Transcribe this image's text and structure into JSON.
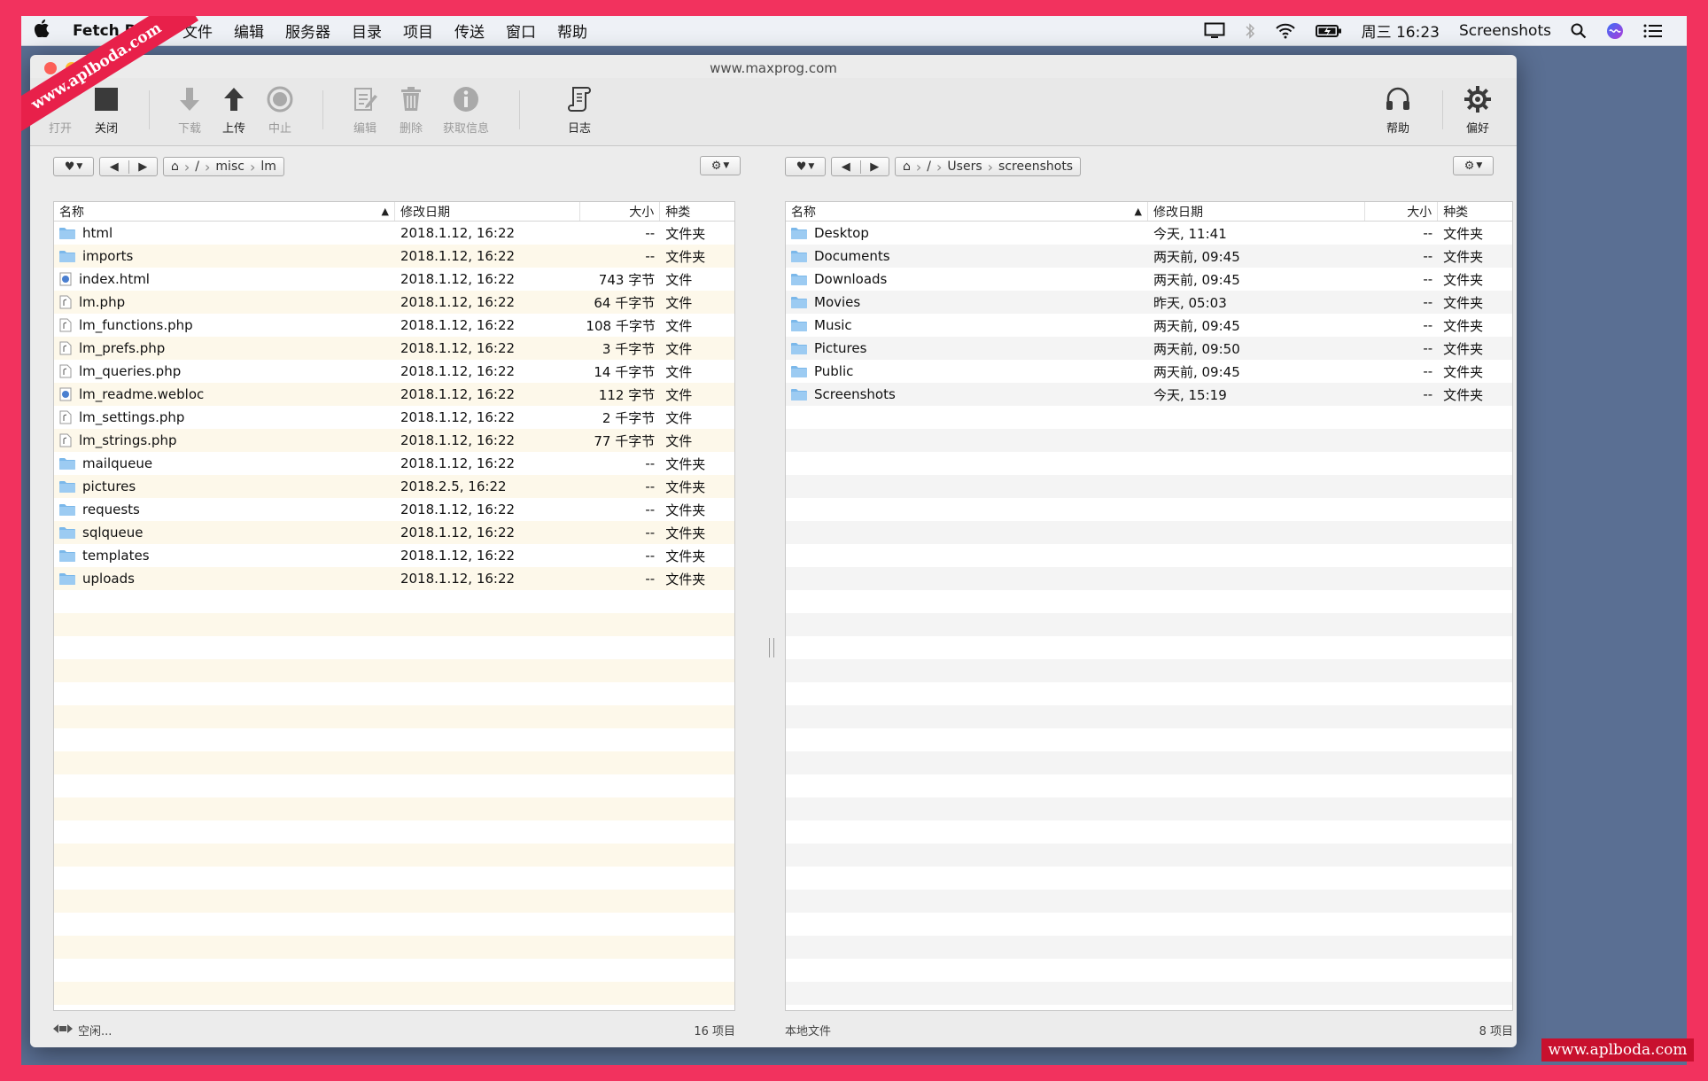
{
  "menubar": {
    "app_name": "Fetch Disk",
    "items": [
      "文件",
      "编辑",
      "服务器",
      "目录",
      "项目",
      "传送",
      "窗口",
      "帮助"
    ],
    "clock": "周三 16:23",
    "screenshots": "Screenshots"
  },
  "window": {
    "title": "www.maxprog.com",
    "toolbar": {
      "open": "打开",
      "close": "关闭",
      "download": "下载",
      "upload": "上传",
      "stop": "中止",
      "edit": "编辑",
      "delete": "删除",
      "get_info": "获取信息",
      "log": "日志",
      "help": "帮助",
      "prefs": "偏好"
    }
  },
  "left_pane": {
    "path": [
      "/",
      "misc",
      "lm"
    ],
    "columns": {
      "name": "名称",
      "date": "修改日期",
      "size": "大小",
      "kind": "种类"
    },
    "rows": [
      {
        "icon": "folder",
        "name": "html",
        "date": "2018.1.12, 16:22",
        "size": "--",
        "kind": "文件夹"
      },
      {
        "icon": "folder",
        "name": "imports",
        "date": "2018.1.12, 16:22",
        "size": "--",
        "kind": "文件夹"
      },
      {
        "icon": "web",
        "name": "index.html",
        "date": "2018.1.12, 16:22",
        "size": "743 字节",
        "kind": "文件"
      },
      {
        "icon": "php",
        "name": "lm.php",
        "date": "2018.1.12, 16:22",
        "size": "64 千字节",
        "kind": "文件"
      },
      {
        "icon": "php",
        "name": "lm_functions.php",
        "date": "2018.1.12, 16:22",
        "size": "108 千字节",
        "kind": "文件"
      },
      {
        "icon": "php",
        "name": "lm_prefs.php",
        "date": "2018.1.12, 16:22",
        "size": "3 千字节",
        "kind": "文件"
      },
      {
        "icon": "php",
        "name": "lm_queries.php",
        "date": "2018.1.12, 16:22",
        "size": "14 千字节",
        "kind": "文件"
      },
      {
        "icon": "web",
        "name": "lm_readme.webloc",
        "date": "2018.1.12, 16:22",
        "size": "112 字节",
        "kind": "文件"
      },
      {
        "icon": "php",
        "name": "lm_settings.php",
        "date": "2018.1.12, 16:22",
        "size": "2 千字节",
        "kind": "文件"
      },
      {
        "icon": "php",
        "name": "lm_strings.php",
        "date": "2018.1.12, 16:22",
        "size": "77 千字节",
        "kind": "文件"
      },
      {
        "icon": "folder",
        "name": "mailqueue",
        "date": "2018.1.12, 16:22",
        "size": "--",
        "kind": "文件夹"
      },
      {
        "icon": "folder",
        "name": "pictures",
        "date": "2018.2.5, 16:22",
        "size": "--",
        "kind": "文件夹"
      },
      {
        "icon": "folder",
        "name": "requests",
        "date": "2018.1.12, 16:22",
        "size": "--",
        "kind": "文件夹"
      },
      {
        "icon": "folder",
        "name": "sqlqueue",
        "date": "2018.1.12, 16:22",
        "size": "--",
        "kind": "文件夹"
      },
      {
        "icon": "folder",
        "name": "templates",
        "date": "2018.1.12, 16:22",
        "size": "--",
        "kind": "文件夹"
      },
      {
        "icon": "folder",
        "name": "uploads",
        "date": "2018.1.12, 16:22",
        "size": "--",
        "kind": "文件夹"
      }
    ],
    "status_left": "空闲...",
    "status_right": "16 项目"
  },
  "right_pane": {
    "path": [
      "/",
      "Users",
      "screenshots"
    ],
    "columns": {
      "name": "名称",
      "date": "修改日期",
      "size": "大小",
      "kind": "种类"
    },
    "rows": [
      {
        "icon": "folder",
        "name": "Desktop",
        "date": "今天, 11:41",
        "size": "--",
        "kind": "文件夹"
      },
      {
        "icon": "folder",
        "name": "Documents",
        "date": "两天前, 09:45",
        "size": "--",
        "kind": "文件夹"
      },
      {
        "icon": "folder",
        "name": "Downloads",
        "date": "两天前, 09:45",
        "size": "--",
        "kind": "文件夹"
      },
      {
        "icon": "folder",
        "name": "Movies",
        "date": "昨天, 05:03",
        "size": "--",
        "kind": "文件夹"
      },
      {
        "icon": "folder",
        "name": "Music",
        "date": "两天前, 09:45",
        "size": "--",
        "kind": "文件夹"
      },
      {
        "icon": "folder",
        "name": "Pictures",
        "date": "两天前, 09:50",
        "size": "--",
        "kind": "文件夹"
      },
      {
        "icon": "folder",
        "name": "Public",
        "date": "两天前, 09:45",
        "size": "--",
        "kind": "文件夹"
      },
      {
        "icon": "folder",
        "name": "Screenshots",
        "date": "今天, 15:19",
        "size": "--",
        "kind": "文件夹"
      }
    ],
    "status_left": "本地文件",
    "status_right": "8 项目"
  },
  "watermarks": {
    "top_left": "www.aplboda.com",
    "bottom_right": "www.aplboda.com"
  },
  "colors": {
    "frame": "#f2325e",
    "desktop": "#5a6f93",
    "folder": "#7bb8ea",
    "row_alt_left": "#fdf8ea",
    "row_alt_right": "#f4f4f4"
  }
}
